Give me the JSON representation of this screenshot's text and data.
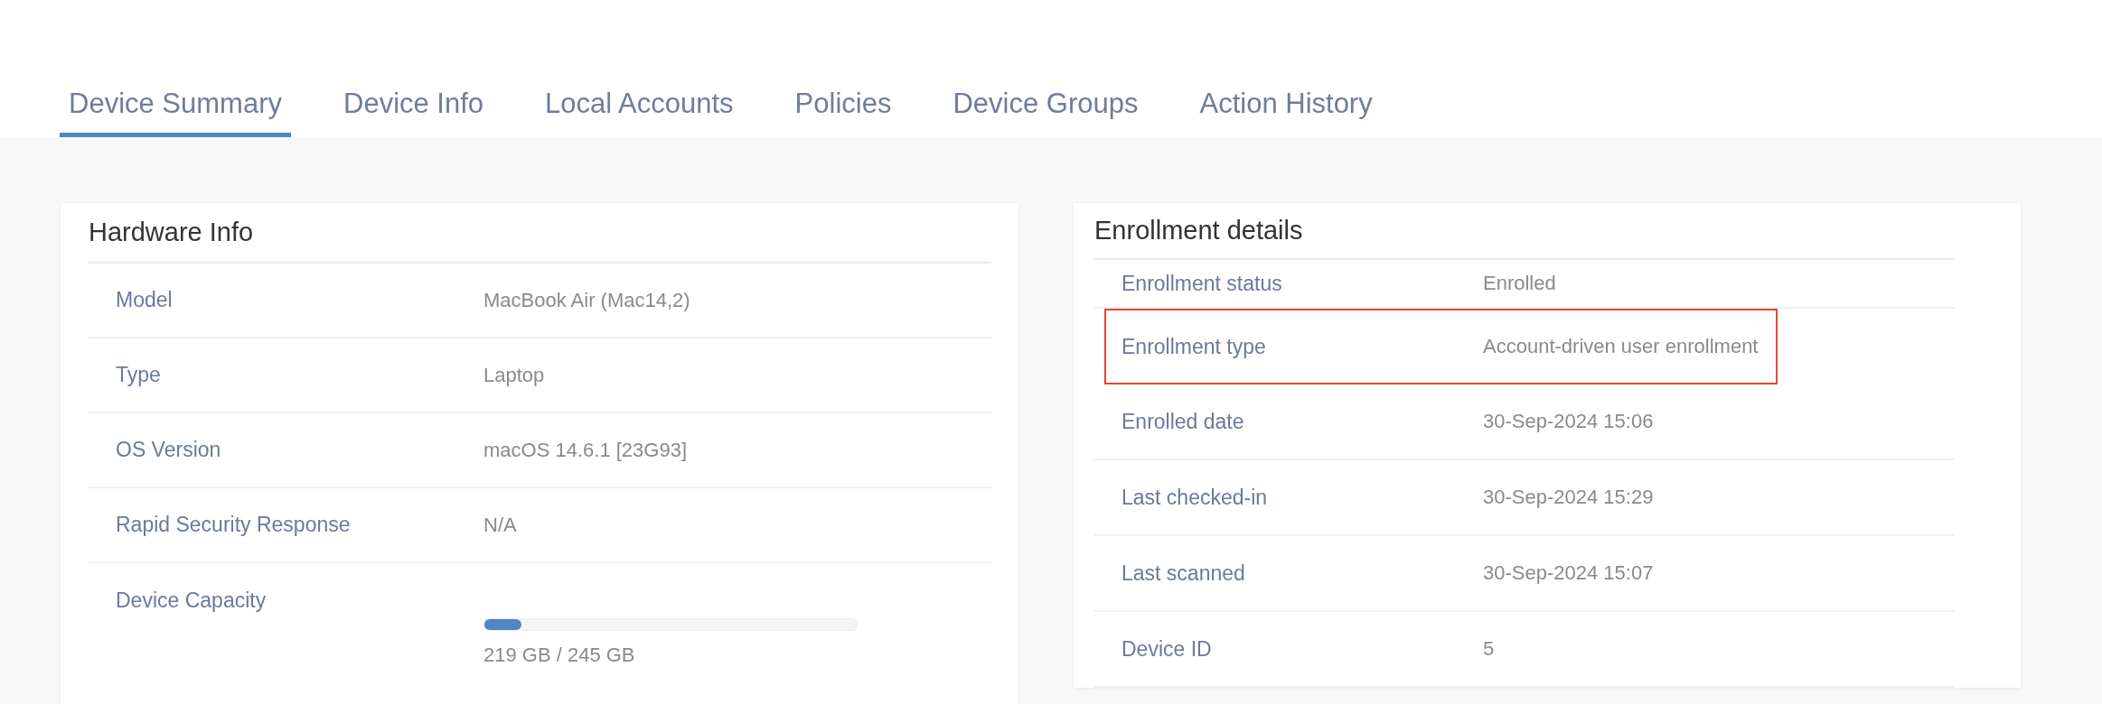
{
  "tabs": [
    {
      "label": "Device Summary",
      "selected": true
    },
    {
      "label": "Device Info",
      "selected": false
    },
    {
      "label": "Local Accounts",
      "selected": false
    },
    {
      "label": "Policies",
      "selected": false
    },
    {
      "label": "Device Groups",
      "selected": false
    },
    {
      "label": "Action History",
      "selected": false
    }
  ],
  "hardware_info": {
    "title": "Hardware Info",
    "rows": [
      {
        "kind": "text",
        "label": "Model",
        "value": "MacBook Air (Mac14,2)"
      },
      {
        "kind": "text",
        "label": "Type",
        "value": "Laptop"
      },
      {
        "kind": "text",
        "label": "OS Version",
        "value": "macOS 14.6.1 [23G93]"
      },
      {
        "kind": "text",
        "label": "Rapid Security Response",
        "value": "N/A"
      },
      {
        "kind": "meter",
        "label": "Device Capacity",
        "level": 0.1,
        "value": "219 GB / 245 GB"
      }
    ]
  },
  "enrollment_details": {
    "title": "Enrollment details",
    "rows": [
      {
        "label": "Enrollment status",
        "value": "Enrolled",
        "highlighted": false
      },
      {
        "label": "Enrollment type",
        "value": "Account-driven user enrollment",
        "highlighted": true
      },
      {
        "label": "Enrolled date",
        "value": "30-Sep-2024 15:06",
        "highlighted": false
      },
      {
        "label": "Last checked-in",
        "value": "30-Sep-2024 15:29",
        "highlighted": false
      },
      {
        "label": "Last scanned",
        "value": "30-Sep-2024 15:07",
        "highlighted": false
      },
      {
        "label": "Device ID",
        "value": "5",
        "highlighted": false
      }
    ]
  }
}
